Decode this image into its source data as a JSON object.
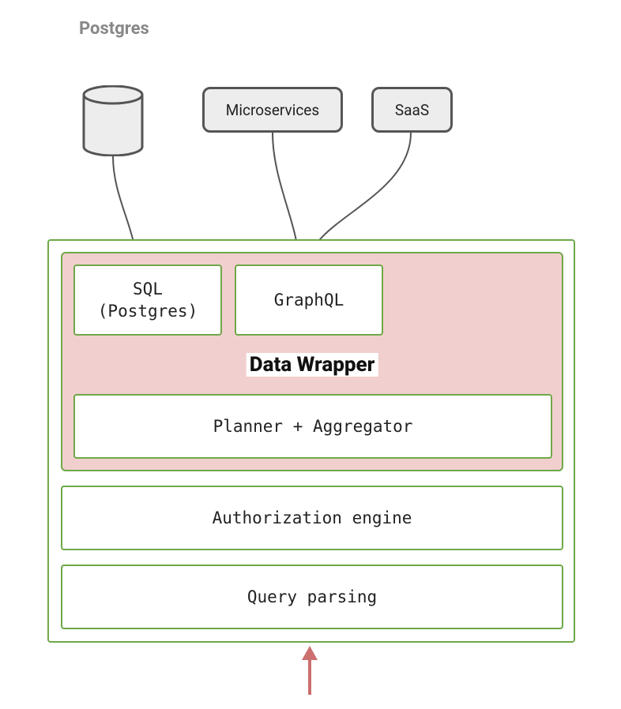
{
  "title": "Postgres",
  "sources": {
    "microservices": "Microservices",
    "saas": "SaaS"
  },
  "wrapper": {
    "title": "Data Wrapper",
    "sql": "SQL\n(Postgres)",
    "graphql": "GraphQL",
    "planner": "Planner + Aggregator"
  },
  "layers": {
    "auth": "Authorization engine",
    "parsing": "Query parsing"
  }
}
